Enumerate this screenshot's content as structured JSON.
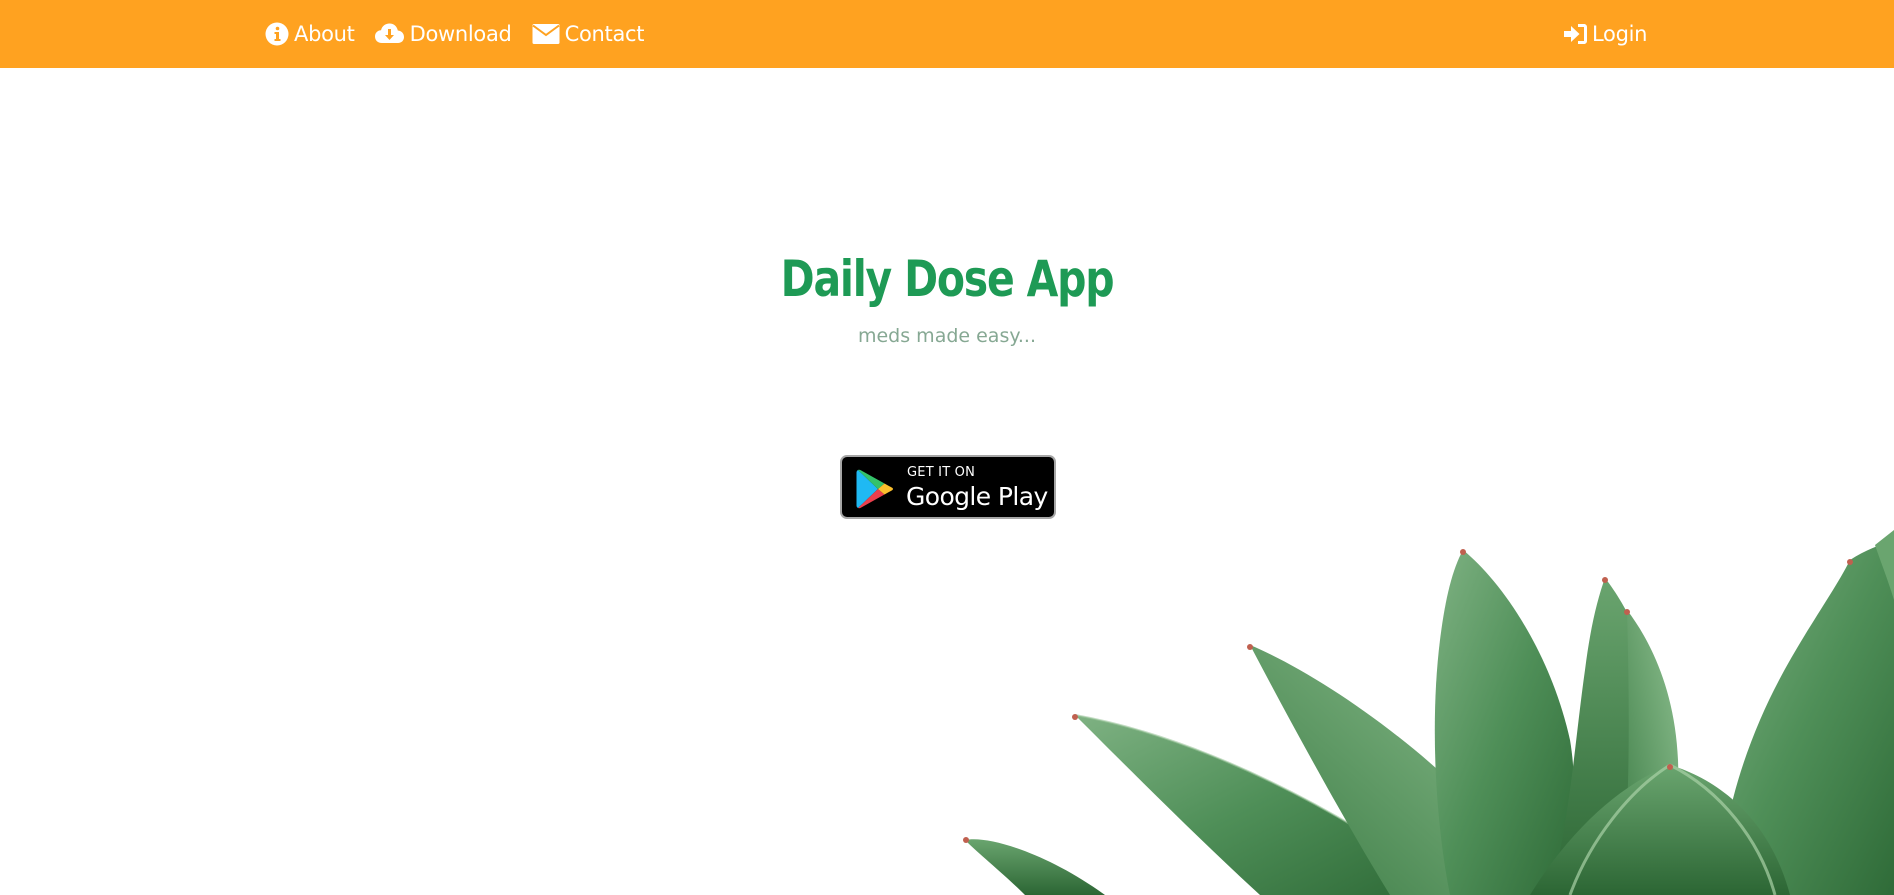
{
  "navbar": {
    "background": "#ffa220",
    "items": [
      {
        "label": "About",
        "icon": "info-circle-icon"
      },
      {
        "label": "Download",
        "icon": "cloud-download-icon"
      },
      {
        "label": "Contact",
        "icon": "envelope-icon"
      }
    ],
    "login": {
      "label": "Login",
      "icon": "sign-in-icon"
    }
  },
  "hero": {
    "title": "Daily Dose App",
    "title_color": "#1e9a55",
    "tagline": "meds made easy...",
    "tagline_color": "#86a893"
  },
  "play_badge": {
    "small_text": "GET IT ON",
    "big_text": "Google Play"
  },
  "decoration": {
    "image": "succulent-plant"
  }
}
